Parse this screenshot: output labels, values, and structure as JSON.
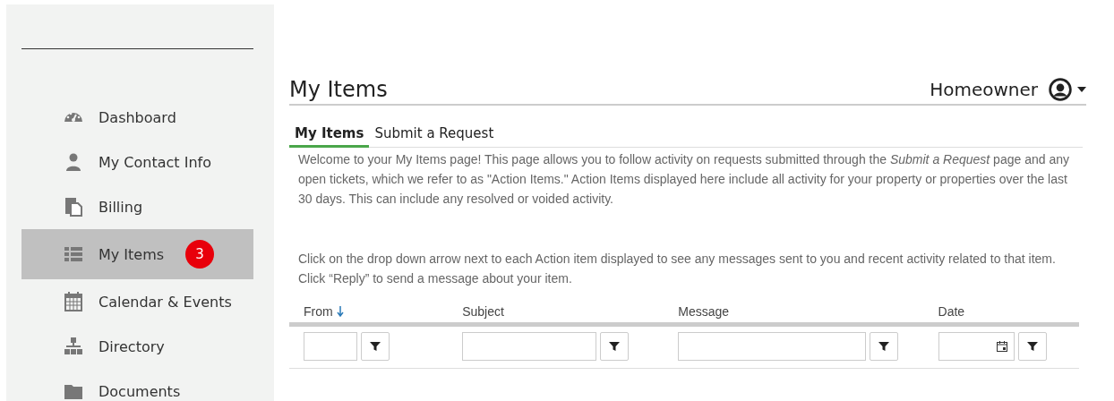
{
  "sidebar": {
    "items": [
      {
        "label": "Dashboard",
        "selected": false
      },
      {
        "label": "My Contact Info",
        "selected": false
      },
      {
        "label": "Billing",
        "selected": false
      },
      {
        "label": "My Items",
        "selected": true,
        "badge": "3"
      },
      {
        "label": "Calendar & Events",
        "selected": false
      },
      {
        "label": "Directory",
        "selected": false
      },
      {
        "label": "Documents",
        "selected": false
      }
    ]
  },
  "header": {
    "title": "My Items",
    "user": "Homeowner"
  },
  "tabs": [
    {
      "label": "My Items",
      "selected": true
    },
    {
      "label": "Submit a Request",
      "selected": false
    }
  ],
  "intro": "Welcome to your My Items page! This page allows you to follow activity on requests submitted through the *Submit a Request* page and any open tickets, which we refer to as \"Action Items.\"  Action Items displayed here include all activity for your property or properties over the last 30 days.  This can include any resolved or voided activity.",
  "instructions": "Click on the drop down arrow next to each  Action item displayed to see any messages sent to you and recent activity related to that item. Click “Reply” to send a message about your item.",
  "table": {
    "columns": [
      {
        "label": "From",
        "sorted": true,
        "kind": "text"
      },
      {
        "label": "Subject",
        "sorted": false,
        "kind": "text"
      },
      {
        "label": "Message",
        "sorted": false,
        "kind": "text"
      },
      {
        "label": "Date",
        "sorted": false,
        "kind": "date"
      }
    ]
  }
}
